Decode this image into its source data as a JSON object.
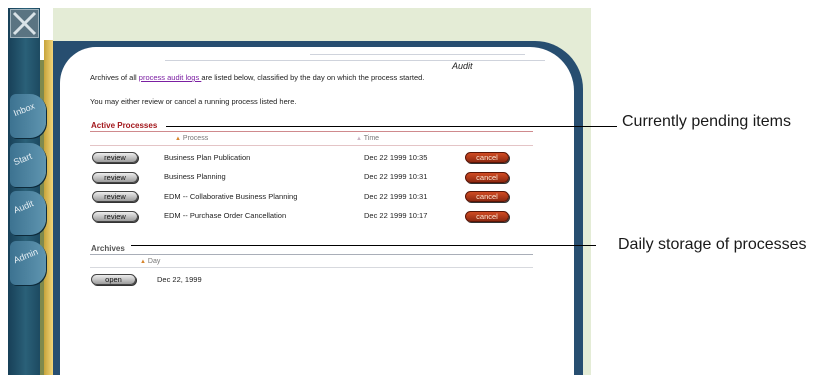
{
  "rail": {
    "tabs": [
      {
        "label": "Inbox",
        "icon": "inbox-tab"
      },
      {
        "label": "Start",
        "icon": "start-tab"
      },
      {
        "label": "Audit",
        "icon": "audit-tab"
      },
      {
        "label": "Admin",
        "icon": "admin-tab"
      }
    ]
  },
  "header": {
    "title": "Audit"
  },
  "intro": {
    "line1_before": "Archives of all ",
    "line1_link": "process audit logs ",
    "line1_after": "are listed below, classified by the day on which the process started.",
    "line2": "You may either review or cancel a running process listed here."
  },
  "active": {
    "heading": "Active Processes",
    "col_process": "Process",
    "col_time": "Time",
    "review_label": "review",
    "cancel_label": "cancel",
    "rows": [
      {
        "process": "Business Plan Publication",
        "time": "Dec 22 1999 10:35"
      },
      {
        "process": "Business Planning",
        "time": "Dec 22 1999 10:31"
      },
      {
        "process": "EDM -- Collaborative Business Planning",
        "time": "Dec 22 1999 10:31"
      },
      {
        "process": "EDM -- Purchase Order Cancellation",
        "time": "Dec 22 1999 10:17"
      }
    ]
  },
  "archives": {
    "heading": "Archives",
    "col_day": "Day",
    "open_label": "open",
    "rows": [
      {
        "day": "Dec 22, 1999"
      }
    ]
  },
  "annotations": {
    "pending": "Currently pending items",
    "storage": "Daily storage of processes"
  },
  "colors": {
    "section_red": "#a3171c",
    "link": "#7b1fa2",
    "cancel_red": "#b53a17",
    "rail_blue": "#274e70",
    "gold": "#e0bb55"
  }
}
